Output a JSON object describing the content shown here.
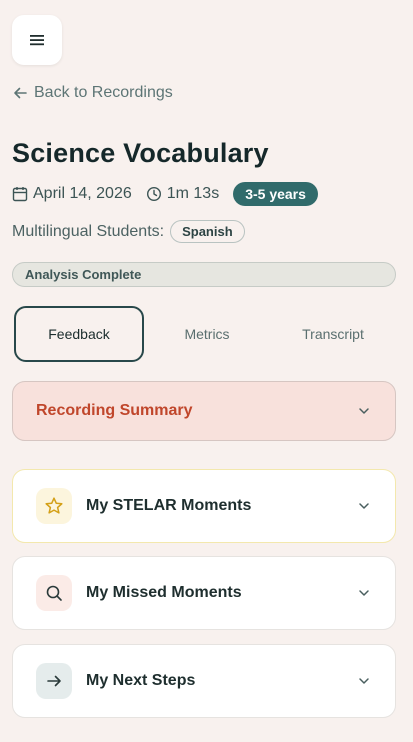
{
  "header": {
    "menu_icon": "hamburger-icon",
    "back_label": "Back to Recordings"
  },
  "recording": {
    "title": "Science Vocabulary",
    "date": "April 14, 2026",
    "duration": "1m 13s",
    "age_range": "3-5 years",
    "multilingual_label": "Multilingual Students:",
    "language": "Spanish",
    "status": "Analysis Complete"
  },
  "tabs": [
    {
      "label": "Feedback",
      "active": true
    },
    {
      "label": "Metrics",
      "active": false
    },
    {
      "label": "Transcript",
      "active": false
    }
  ],
  "sections": {
    "summary": {
      "title": "Recording Summary",
      "color": "#c0462b"
    },
    "stelar": {
      "title": "My STELAR Moments",
      "icon": "star-icon"
    },
    "missed": {
      "title": "My Missed Moments",
      "icon": "search-icon"
    },
    "next": {
      "title": "My Next Steps",
      "icon": "arrow-right-icon"
    }
  },
  "colors": {
    "background": "#f8f1ee",
    "accent": "#316b6b",
    "star": "#d4a017"
  }
}
